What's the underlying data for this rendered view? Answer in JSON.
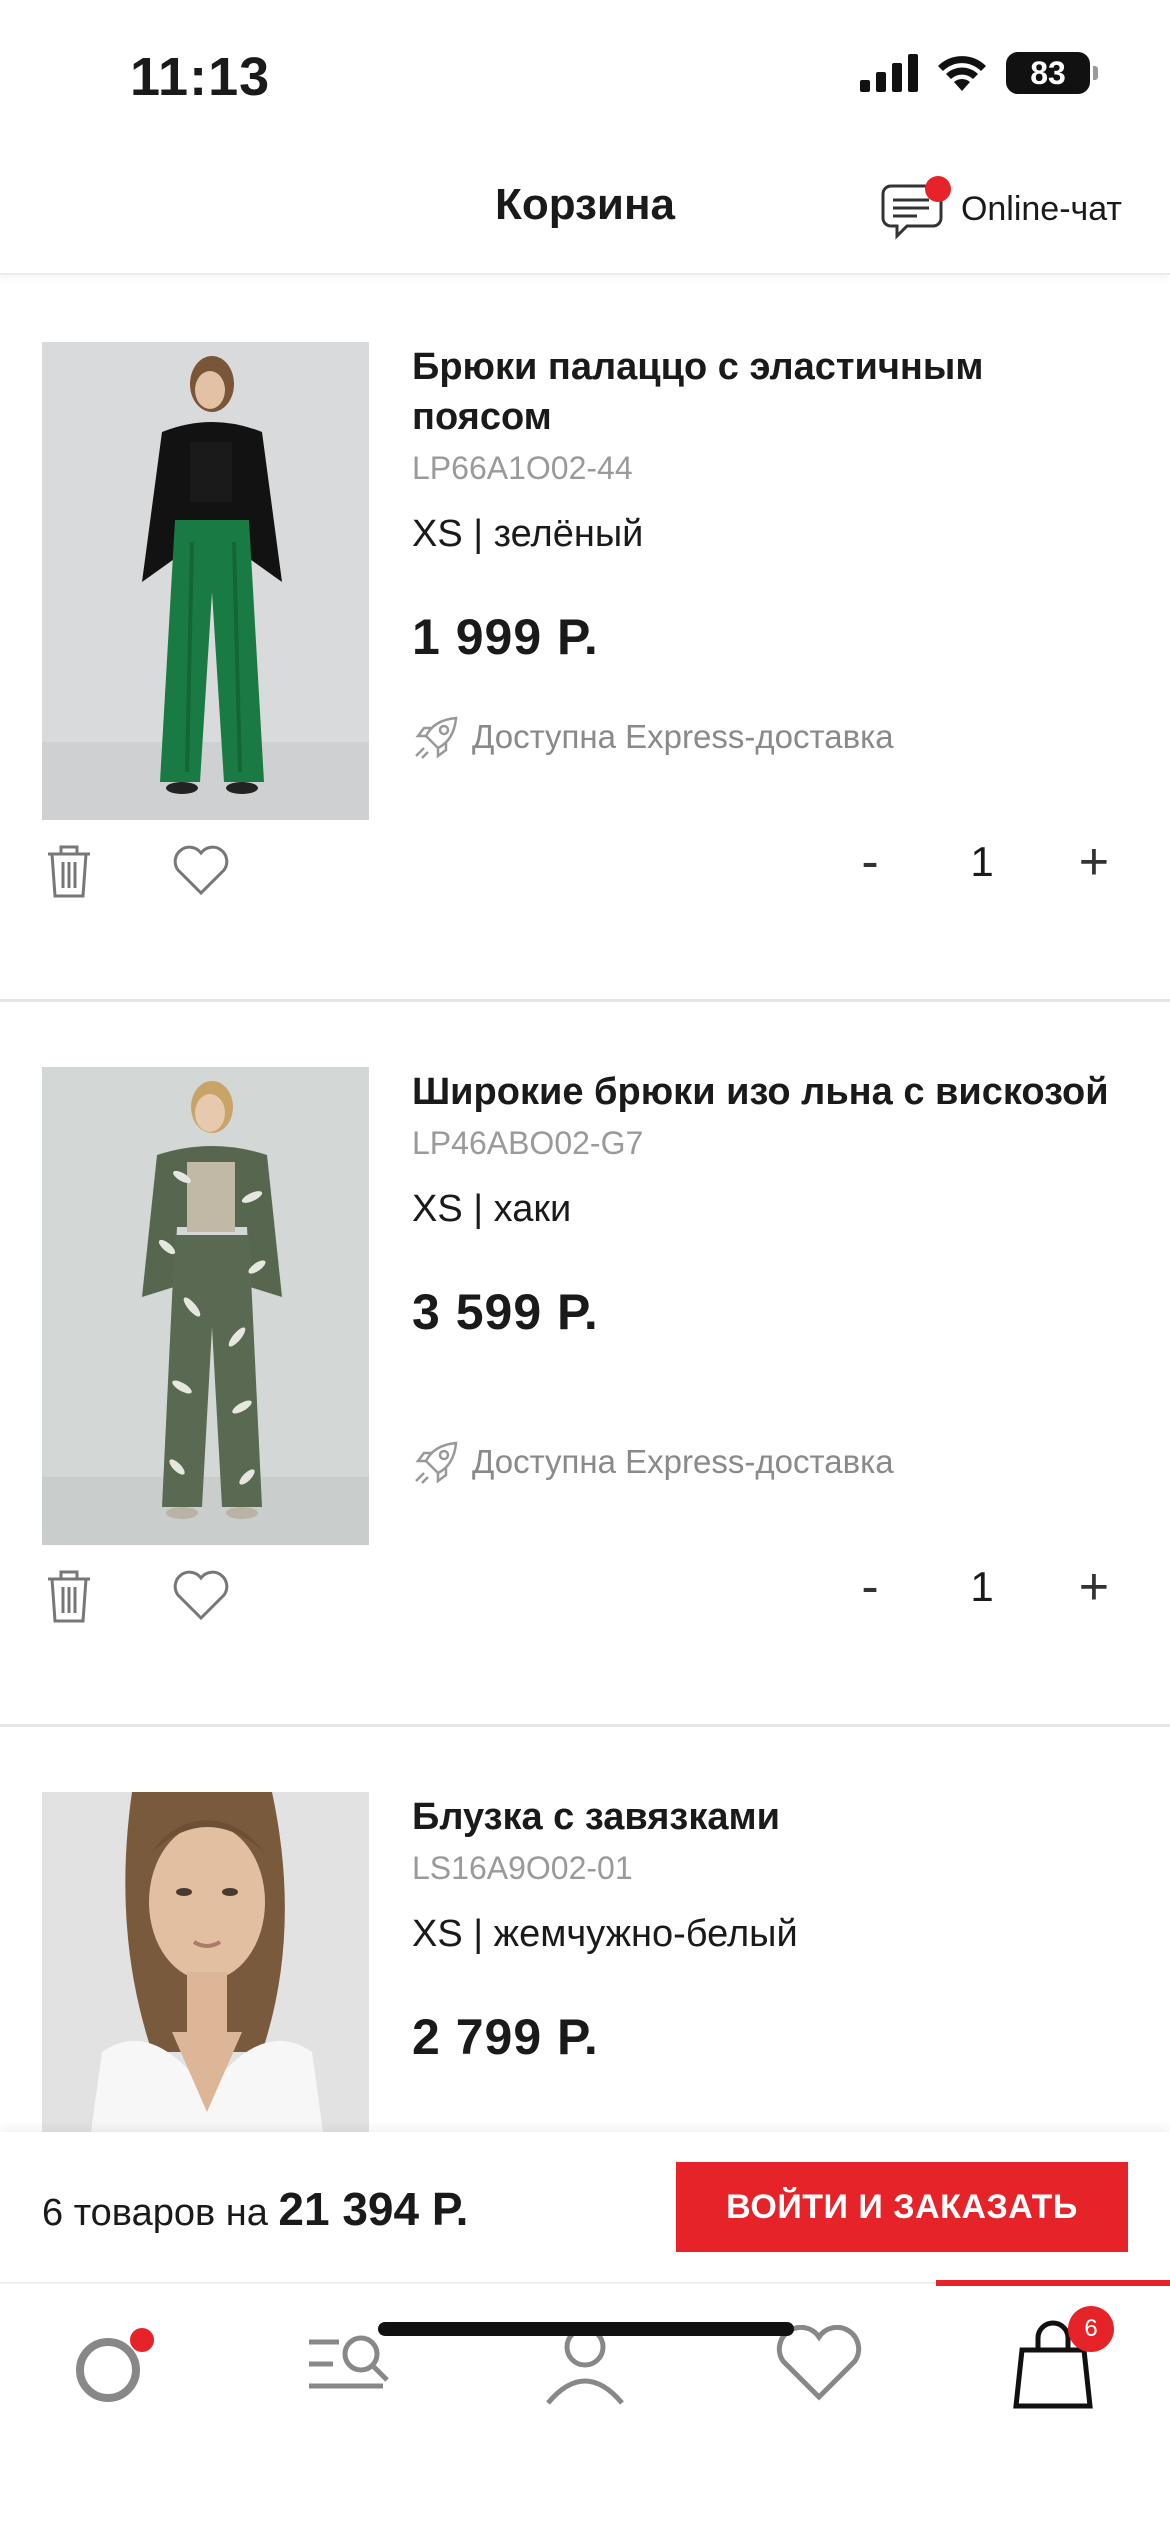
{
  "status": {
    "time": "11:13",
    "battery": "83"
  },
  "header": {
    "title": "Корзина",
    "chat_label": "Online-чат"
  },
  "items": [
    {
      "name": "Брюки палаццо с эластичным поясом",
      "sku": "LP66A1O02-44",
      "variant": "XS | зелёный",
      "price": "1 999 Р.",
      "express": "Доступна Express-доставка",
      "qty": "1",
      "minus": "-",
      "plus": "+"
    },
    {
      "name": "Широкие брюки изо льна с вискозой",
      "sku": "LP46ABO02-G7",
      "variant": "XS | хаки",
      "price": "3 599 Р.",
      "express": "Доступна Express-доставка",
      "qty": "1",
      "minus": "-",
      "plus": "+"
    },
    {
      "name": "Блузка с завязками",
      "sku": "LS16A9O02-01",
      "variant": "XS | жемчужно-белый",
      "price": "2 799 Р."
    }
  ],
  "checkout": {
    "count_text": "6 товаров на",
    "total": "21 394 Р.",
    "button": "ВОЙТИ И ЗАКАЗАТЬ"
  },
  "tabbar": {
    "cart_badge": "6"
  },
  "colors": {
    "accent": "#e52329"
  }
}
